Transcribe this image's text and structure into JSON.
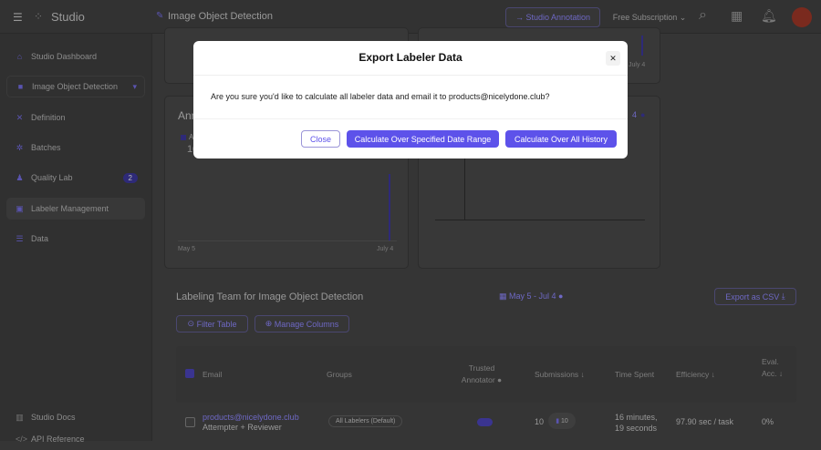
{
  "header": {
    "app_name": "Studio",
    "project": "Image Object Detection",
    "studio_annotation": "Studio Annotation",
    "subscription": "Free Subscription"
  },
  "sidebar": {
    "items": [
      {
        "label": "Studio Dashboard",
        "icon": "home-icon"
      },
      {
        "label": "Image Object Detection",
        "icon": "folder-icon"
      },
      {
        "label": "Definition",
        "icon": "tools-icon"
      },
      {
        "label": "Batches",
        "icon": "run-icon"
      },
      {
        "label": "Quality Lab",
        "icon": "flask-icon",
        "badge": "2"
      },
      {
        "label": "Labeler Management",
        "icon": "id-card-icon"
      },
      {
        "label": "Data",
        "icon": "database-icon"
      }
    ],
    "bottom": [
      {
        "label": "Studio Docs"
      },
      {
        "label": "API Reference"
      }
    ]
  },
  "charts": {
    "top_right_end": "July 4",
    "left_title": "Ann",
    "left_legend": "A",
    "left_value": "10",
    "left_start": "May 5",
    "left_end": "July 4",
    "right_date": "4"
  },
  "team": {
    "title": "Labeling Team for Image Object Detection",
    "date_range": "May 5 - Jul 4",
    "export": "Export as CSV",
    "filter": "Filter Table",
    "manage": "Manage Columns",
    "columns": [
      "Email",
      "Groups",
      "Trusted Annotator",
      "Submissions",
      "Time Spent",
      "Efficiency",
      "Eval. Acc."
    ],
    "rows": [
      {
        "email": "products@nicelydone.club",
        "role": "Attempter + Reviewer",
        "group": "All Labelers (Default)",
        "trusted": true,
        "submissions": "10",
        "sub_badge": "10",
        "time": "16 minutes, 19 seconds",
        "efficiency": "97.90 sec / task",
        "eval": "0%"
      }
    ]
  },
  "modal": {
    "title": "Export Labeler Data",
    "message": "Are you sure you'd like to calculate all labeler data and email it to products@nicelydone.club?",
    "close": "Close",
    "specified": "Calculate Over Specified Date Range",
    "all": "Calculate Over All History"
  },
  "colors": {
    "accent": "#5d52ea"
  }
}
